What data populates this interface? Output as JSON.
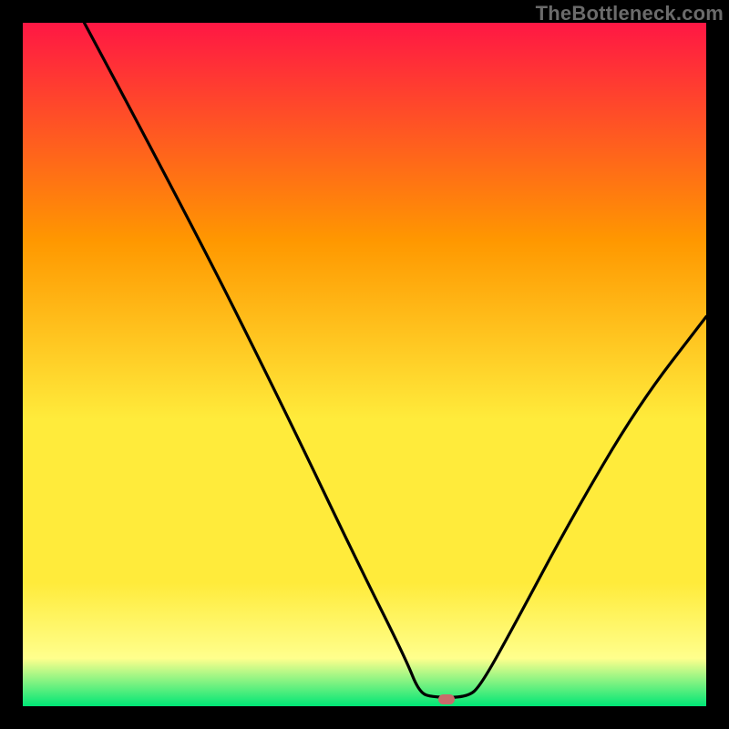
{
  "watermark": "TheBottleneck.com",
  "chart_data": {
    "type": "line",
    "title": "",
    "xlabel": "",
    "ylabel": "",
    "xlim": [
      0,
      100
    ],
    "ylim": [
      0,
      100
    ],
    "grid": false,
    "legend": false,
    "annotations": [],
    "gradient_colors": {
      "top": "#ff1744",
      "upper_mid": "#ff9800",
      "mid": "#ffeb3b",
      "lower_mid": "#ffff8d",
      "bottom": "#00e676"
    },
    "marker": {
      "x": 62,
      "y": 1,
      "color": "#c96b6b"
    },
    "series": [
      {
        "name": "bottleneck-curve",
        "color": "#000000",
        "points": [
          {
            "x": 9,
            "y": 100
          },
          {
            "x": 24,
            "y": 72
          },
          {
            "x": 38,
            "y": 44
          },
          {
            "x": 49,
            "y": 21
          },
          {
            "x": 56,
            "y": 7
          },
          {
            "x": 58,
            "y": 2
          },
          {
            "x": 60,
            "y": 1.3
          },
          {
            "x": 65,
            "y": 1.3
          },
          {
            "x": 67,
            "y": 3
          },
          {
            "x": 72,
            "y": 12
          },
          {
            "x": 80,
            "y": 27
          },
          {
            "x": 90,
            "y": 44
          },
          {
            "x": 100,
            "y": 57
          }
        ]
      }
    ]
  }
}
